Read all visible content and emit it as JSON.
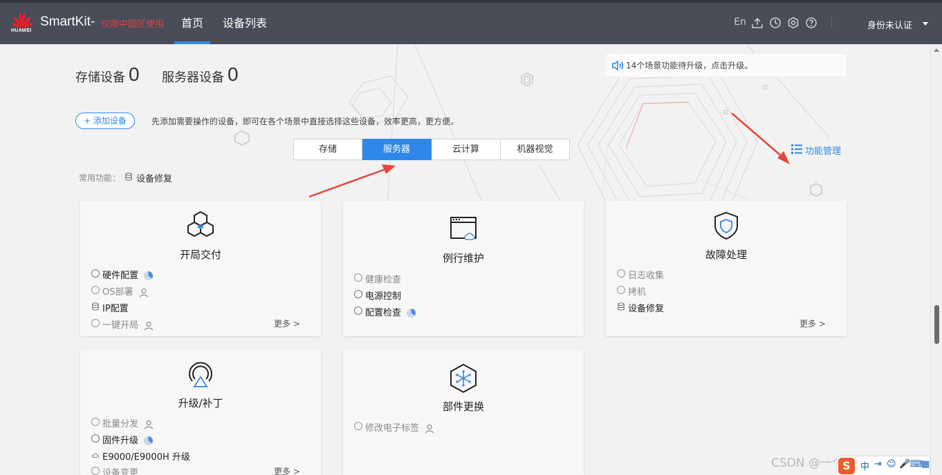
{
  "header": {
    "logo_text": "HUAWEI",
    "brand": "SmartKit-",
    "brand_sub": "仅限中国区使用",
    "nav": [
      "首页",
      "设备列表"
    ],
    "lang": "En",
    "user": "身份未认证"
  },
  "stats": {
    "storage_label": "存储设备",
    "storage_value": "0",
    "server_label": "服务器设备",
    "server_value": "0"
  },
  "notice": "14个场景功能待升级，点击升级。",
  "add_device": {
    "label": "+ 添加设备",
    "hint": "先添加需要操作的设备，即可在各个场景中直接选择这些设备，效率更高，更方便。"
  },
  "tabs": [
    "存储",
    "服务器",
    "云计算",
    "机器视觉"
  ],
  "active_tab": "服务器",
  "func_mgmt": "功能管理",
  "common": {
    "label": "常用功能：",
    "item": "设备修复"
  },
  "cards": [
    {
      "title": "开局交付",
      "icon": "hexagon-cluster-icon",
      "items": [
        {
          "text": "硬件配置",
          "marker": "radio",
          "dim": false,
          "badge": "pie"
        },
        {
          "text": "OS部署",
          "marker": "radio",
          "dim": true,
          "badge": "user"
        },
        {
          "text": "IP配置",
          "marker": "db",
          "dim": false,
          "badge": ""
        },
        {
          "text": "一键开局",
          "marker": "radio",
          "dim": true,
          "badge": "user"
        }
      ],
      "more": "更多 >"
    },
    {
      "title": "例行维护",
      "icon": "window-cloud-icon",
      "items": [
        {
          "text": "健康检查",
          "marker": "radio",
          "dim": true,
          "badge": ""
        },
        {
          "text": "电源控制",
          "marker": "radio",
          "dim": false,
          "badge": ""
        },
        {
          "text": "配置检查",
          "marker": "radio",
          "dim": false,
          "badge": "pie"
        }
      ],
      "more": ""
    },
    {
      "title": "故障处理",
      "icon": "shield-icon",
      "items": [
        {
          "text": "日志收集",
          "marker": "radio",
          "dim": true,
          "badge": ""
        },
        {
          "text": "拷机",
          "marker": "radio",
          "dim": true,
          "badge": ""
        },
        {
          "text": "设备修复",
          "marker": "db",
          "dim": false,
          "badge": ""
        }
      ],
      "more": "更多 >"
    },
    {
      "title": "升级/补丁",
      "icon": "upgrade-ring-icon",
      "items": [
        {
          "text": "批量分发",
          "marker": "radio",
          "dim": true,
          "badge": "user"
        },
        {
          "text": "固件升级",
          "marker": "radio",
          "dim": false,
          "badge": "pie"
        },
        {
          "text": "E9000/E9000H 升级",
          "marker": "cloud",
          "dim": false,
          "badge": ""
        },
        {
          "text": "设备变更",
          "marker": "radio",
          "dim": true,
          "badge": ""
        }
      ],
      "more": "更多 >"
    },
    {
      "title": "部件更换",
      "icon": "hexagon-network-icon",
      "items": [
        {
          "text": "修改电子标签",
          "marker": "radio",
          "dim": true,
          "badge": "user"
        }
      ],
      "more": ""
    }
  ],
  "watermark": "CSDN @一个不专业的研究",
  "ime": {
    "logo": "S",
    "mode": "中"
  },
  "colors": {
    "topbar": "#494c59",
    "accent": "#2f88e8",
    "brand_sub": "#e0413f",
    "arrow": "#e8443a"
  }
}
